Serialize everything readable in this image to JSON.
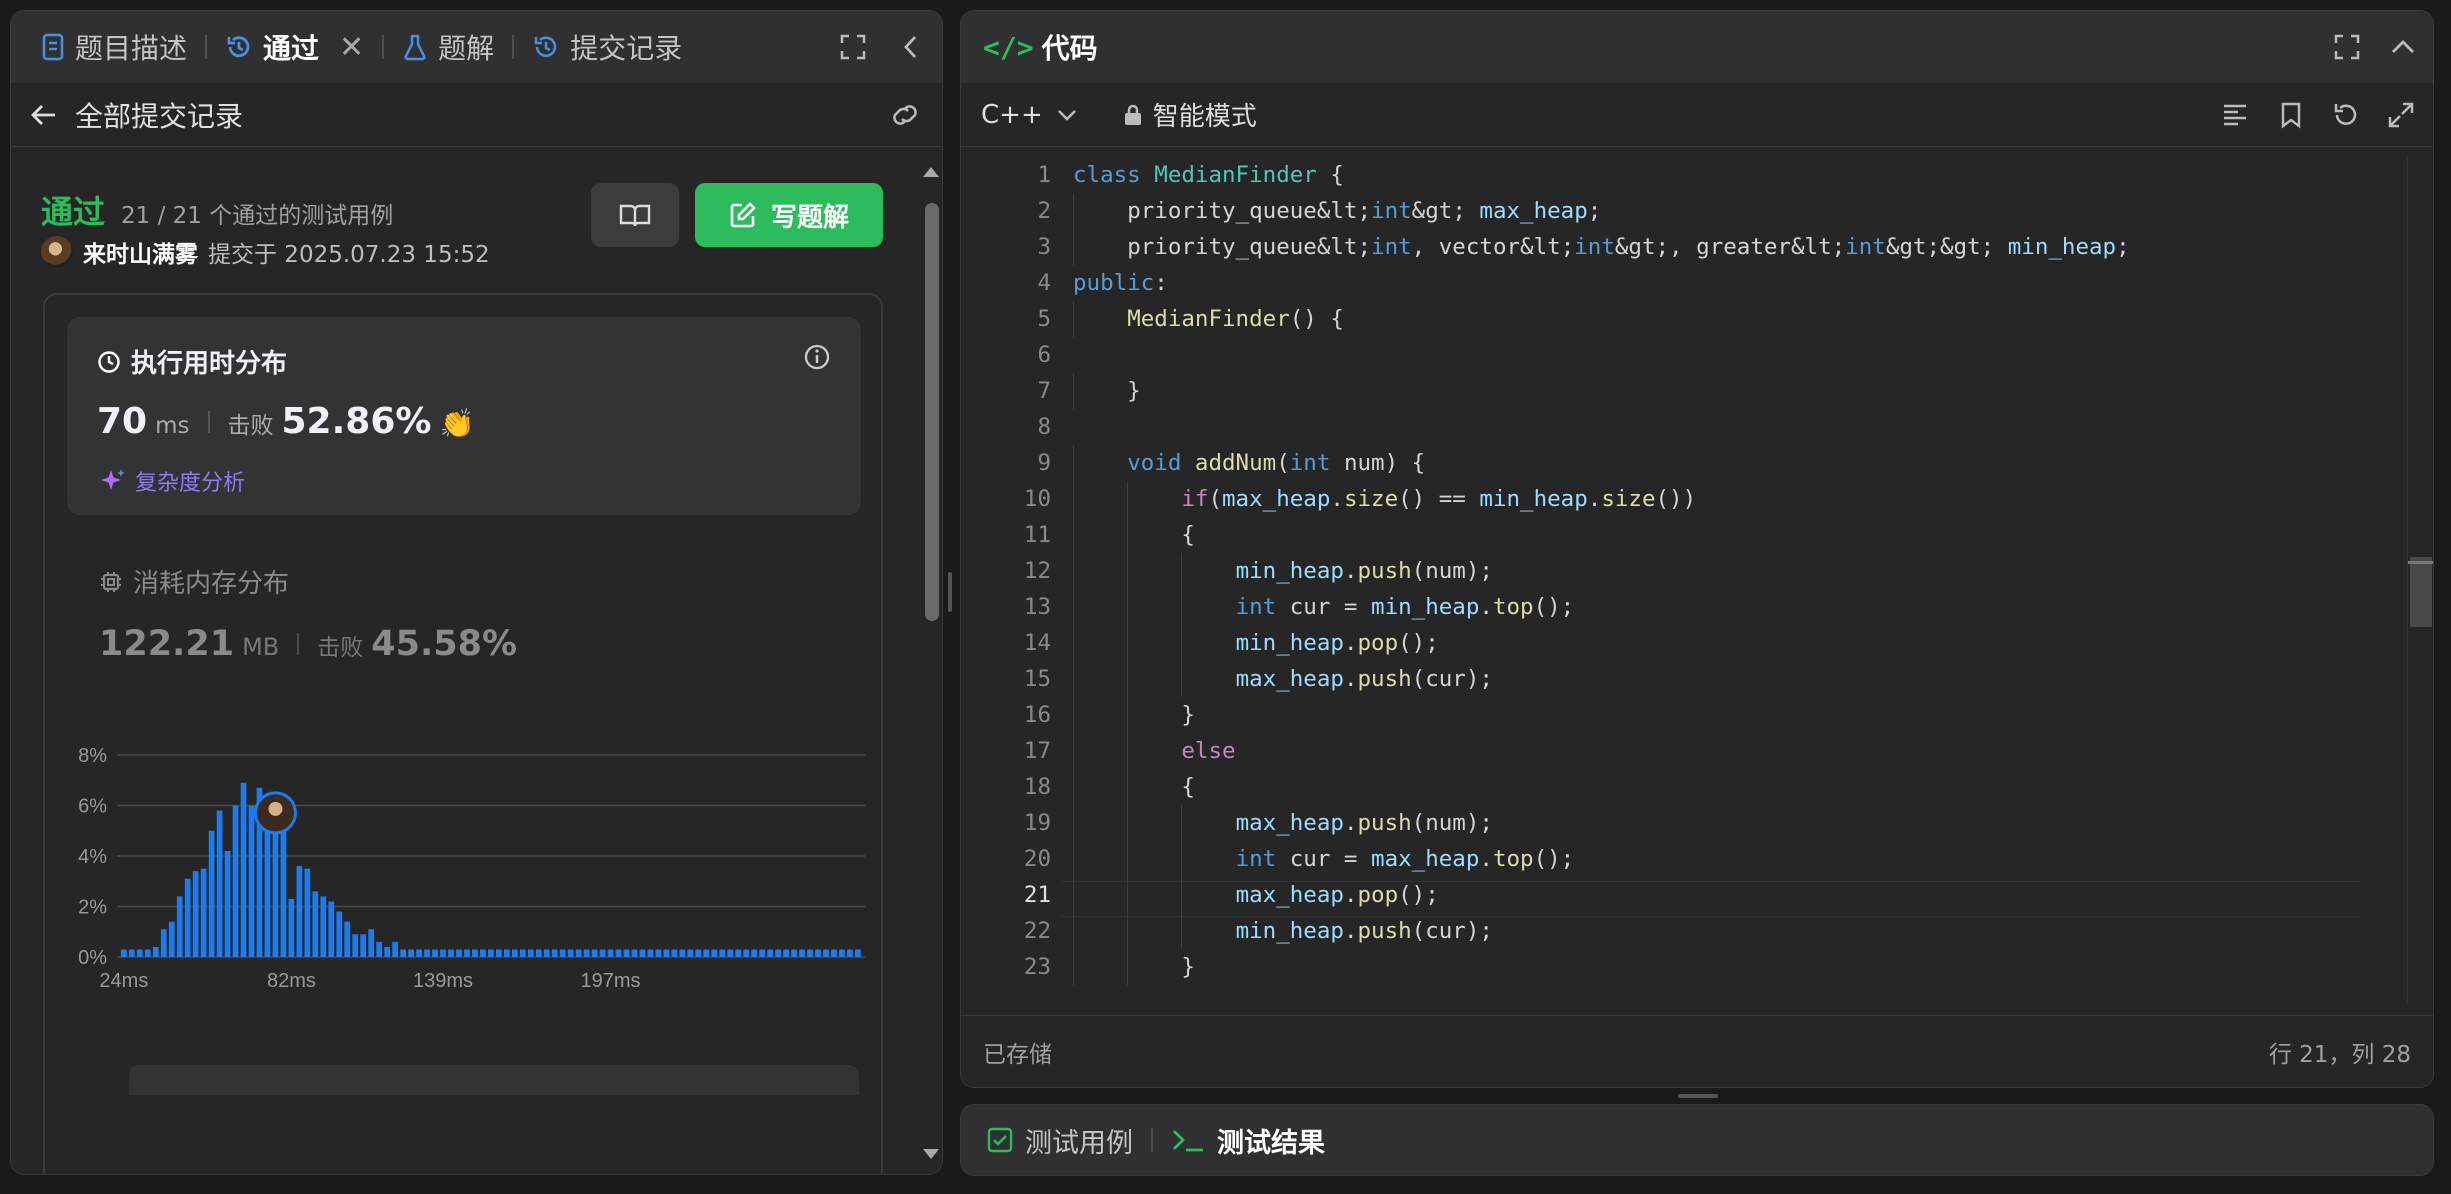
{
  "left": {
    "tabs": [
      {
        "label": "题目描述"
      },
      {
        "label": "通过"
      },
      {
        "label": "题解"
      },
      {
        "label": "提交记录"
      }
    ],
    "back_label": "全部提交记录",
    "result": {
      "status": "通过",
      "cases": "21 / 21  个通过的测试用例",
      "user": "来时山满雾",
      "submitted": "提交于 2025.07.23 15:52",
      "write_solution": "写题解"
    },
    "runtime": {
      "title": "执行用时分布",
      "value": "70",
      "unit": "ms",
      "beat_label": "击败",
      "beat_value": "52.86%",
      "complexity": "复杂度分析"
    },
    "memory": {
      "title": "消耗内存分布",
      "value": "122.21",
      "unit": "MB",
      "beat_label": "击败",
      "beat_value": "45.58%"
    }
  },
  "chart_data": {
    "type": "bar",
    "ylim": [
      0,
      8
    ],
    "ytick_labels": [
      "0%",
      "2%",
      "4%",
      "6%",
      "8%"
    ],
    "xtick_labels": [
      "24ms",
      "82ms",
      "139ms",
      "197ms"
    ],
    "values": [
      0.3,
      0.3,
      0.3,
      0.3,
      0.4,
      1.1,
      1.4,
      2.4,
      3.1,
      3.4,
      3.5,
      5.0,
      5.8,
      4.2,
      6.0,
      6.9,
      6.0,
      6.7,
      5.4,
      6.5,
      5.3,
      2.3,
      3.6,
      3.5,
      2.6,
      2.4,
      2.2,
      1.8,
      1.4,
      0.9,
      0.9,
      1.1,
      0.6,
      0.4,
      0.6,
      0.3,
      0.3,
      0.3,
      0.3,
      0.3,
      0.3,
      0.3,
      0.3,
      0.3,
      0.3,
      0.3,
      0.3,
      0.3,
      0.3,
      0.3,
      0.3,
      0.3,
      0.3,
      0.3,
      0.3,
      0.3,
      0.3,
      0.3,
      0.3,
      0.3,
      0.3,
      0.3,
      0.3,
      0.3,
      0.3,
      0.3,
      0.3,
      0.3,
      0.3,
      0.3,
      0.3,
      0.3,
      0.3,
      0.3,
      0.3,
      0.3,
      0.3,
      0.3,
      0.3,
      0.3,
      0.3,
      0.3,
      0.3,
      0.3,
      0.3,
      0.3,
      0.3,
      0.3,
      0.3,
      0.3,
      0.3,
      0.3,
      0.3
    ],
    "highlight_index": 19,
    "bar_color": "#1a7cf0"
  },
  "editor": {
    "title": "代码",
    "language": "C++",
    "mode": "智能模式",
    "status_left": "已存储",
    "status_right": "行 21，列 28",
    "current_line": 21,
    "lines": [
      "class MedianFinder {",
      "    priority_queue<int> max_heap;",
      "    priority_queue<int, vector<int>, greater<int>> min_heap;",
      "public:",
      "    MedianFinder() {",
      "",
      "    }",
      "",
      "    void addNum(int num) {",
      "        if(max_heap.size() == min_heap.size())",
      "        {",
      "            min_heap.push(num);",
      "            int cur = min_heap.top();",
      "            min_heap.pop();",
      "            max_heap.push(cur);",
      "        }",
      "        else",
      "        {",
      "            max_heap.push(num);",
      "            int cur = max_heap.top();",
      "            max_heap.pop();",
      "            min_heap.push(cur);",
      "        }"
    ]
  },
  "bottom": {
    "tab1": "测试用例",
    "tab2": "测试结果"
  }
}
